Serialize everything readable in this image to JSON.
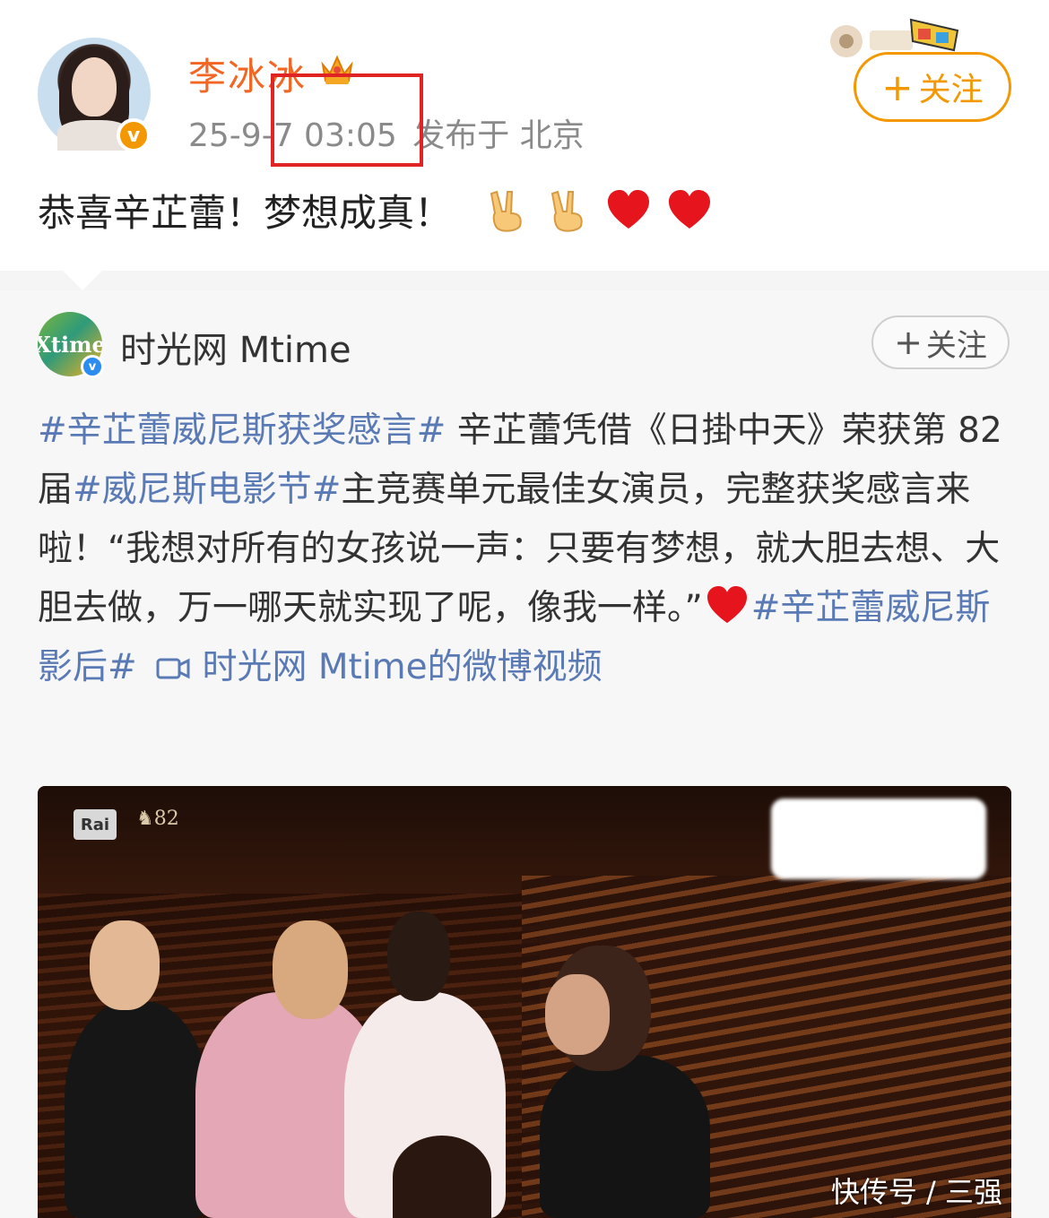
{
  "post": {
    "username": "李冰冰",
    "time": "25-9-7 03:05",
    "location": "发布于 北京",
    "text": "恭喜辛芷蕾！梦想成真！",
    "follow_label": "关注",
    "follow_plus": "+",
    "verified_mark": "v",
    "emojis": [
      "victory-hand",
      "victory-hand",
      "red-heart",
      "red-heart"
    ]
  },
  "repost": {
    "username": "时光网 Mtime",
    "logo_text": "Xtime",
    "follow_label": "关注",
    "follow_plus": "+",
    "verified_mark": "v",
    "tag1": "#辛芷蕾威尼斯获奖感言#",
    "text1": " 辛芷蕾凭借《日掛中天》荣获第 82 届",
    "tag2": "#威尼斯电影节#",
    "text2": "主竞赛单元最佳女演员，完整获奖感言来啦！“我想对所有的女孩说一声：只要有梦想，就大胆去想、大胆去做，万一哪天就实现了呢，像我一样。”",
    "tag3": "#辛芷蕾威尼斯影后#",
    "video_link": " 时光网 Mtime的微博视频"
  },
  "video": {
    "rai_label": "Rai",
    "venice_label": "82"
  },
  "watermark": "快传号 / 三强",
  "colors": {
    "username_orange": "#f26522",
    "follow_orange": "#f39800",
    "highlight_red": "#e02424",
    "topic_blue": "#5a7ab6"
  }
}
